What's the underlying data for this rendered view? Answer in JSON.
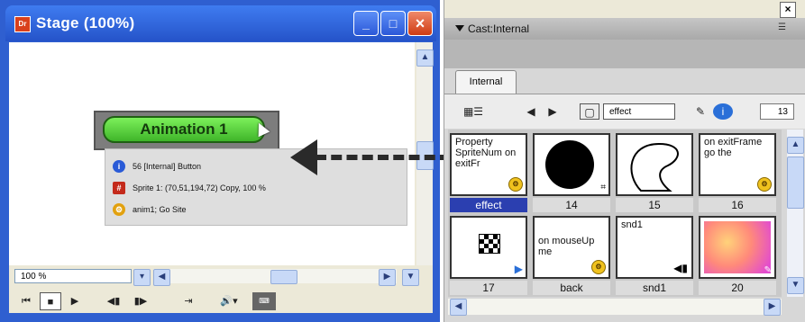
{
  "stage": {
    "title": "Stage (100%)",
    "app_icon": "director-icon",
    "window_buttons": [
      "minimize",
      "maximize",
      "close"
    ],
    "sprite_button_label": "Animation 1",
    "info_rows": [
      {
        "icon": "info-icon",
        "text": "56 [Internal] Button"
      },
      {
        "icon": "sprite-icon",
        "text": "Sprite 1: (70,51,194,72) Copy, 100 %"
      },
      {
        "icon": "behavior-icon",
        "text": "anim1; Go Site"
      }
    ],
    "zoom_value": "100 %"
  },
  "cast": {
    "panel_title": "Cast:Internal",
    "tab": "Internal",
    "member_name": "effect",
    "member_number": "13",
    "members": [
      {
        "kind": "script",
        "text": "Property SpriteNum on exitFr",
        "label": "effect",
        "selected": true
      },
      {
        "kind": "bitmap-circle",
        "text": "",
        "label": "14",
        "selected": false
      },
      {
        "kind": "vector",
        "text": "",
        "label": "15",
        "selected": false
      },
      {
        "kind": "script",
        "text": "on exitFrame go the",
        "label": "16",
        "selected": false
      },
      {
        "kind": "button",
        "text": "",
        "label": "17",
        "selected": false
      },
      {
        "kind": "script",
        "text": "on mouseUp me",
        "label": "back",
        "selected": false
      },
      {
        "kind": "sound",
        "text": "snd1",
        "label": "snd1",
        "selected": false
      },
      {
        "kind": "bitmap-gradient",
        "text": "",
        "label": "20",
        "selected": false
      }
    ]
  },
  "colors": {
    "xp_blue": "#2f5fd0",
    "selected_label": "#2b3fb0",
    "button_green": "#3fb52a",
    "close_red": "#cf3b13"
  }
}
